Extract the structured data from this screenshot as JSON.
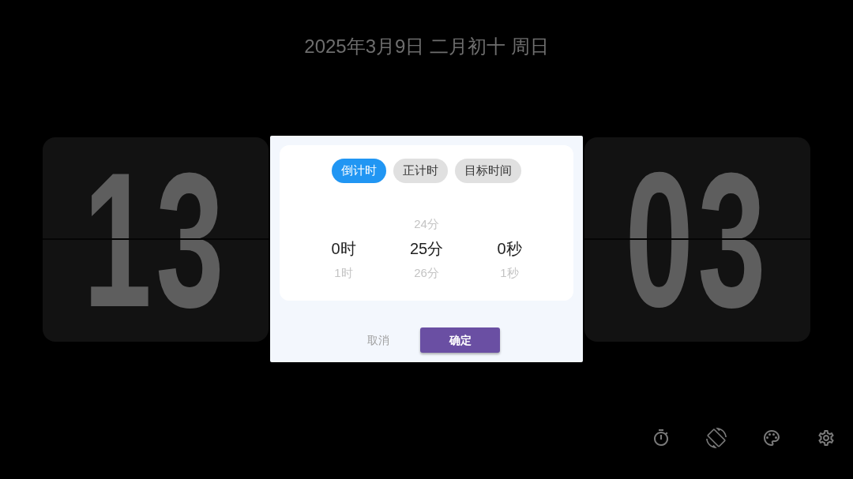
{
  "date_line": "2025年3月9日 二月初十 周日",
  "clock": {
    "hours": "13",
    "minutes": "03"
  },
  "dialog": {
    "mode_tabs": [
      {
        "label": "倒计时",
        "selected": true
      },
      {
        "label": "正计时",
        "selected": false
      },
      {
        "label": "目标时间",
        "selected": false
      }
    ],
    "picker_columns": [
      {
        "items": [
          {
            "text": "0时",
            "selected": true
          },
          {
            "text": "1时",
            "selected": false
          }
        ]
      },
      {
        "items": [
          {
            "text": "24分",
            "selected": false
          },
          {
            "text": "25分",
            "selected": true
          },
          {
            "text": "26分",
            "selected": false
          }
        ]
      },
      {
        "items": [
          {
            "text": "0秒",
            "selected": true
          },
          {
            "text": "1秒",
            "selected": false
          }
        ]
      }
    ],
    "cancel_button": "取消",
    "confirm_button": "确定"
  }
}
